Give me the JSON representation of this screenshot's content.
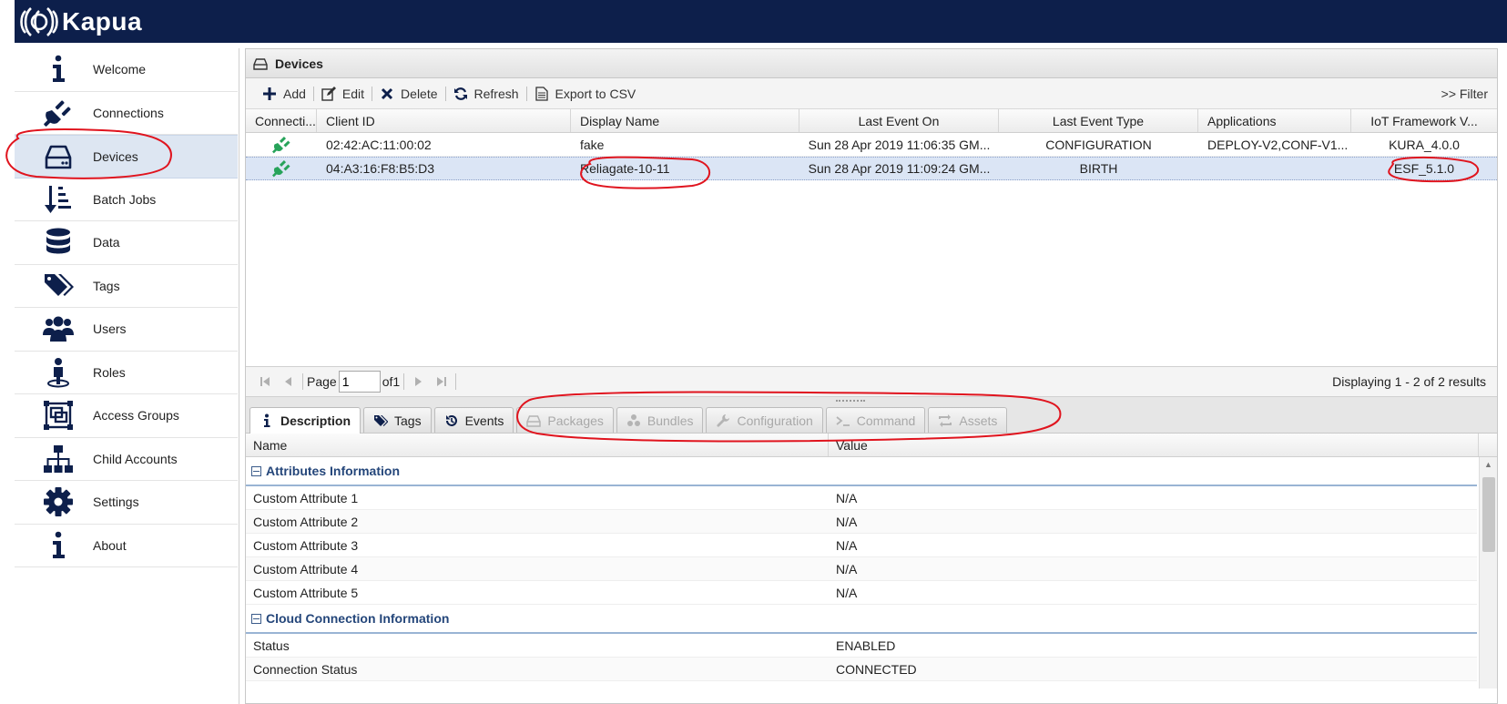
{
  "app": {
    "title": "Kapua"
  },
  "sidebar": {
    "items": [
      {
        "label": "Welcome",
        "icon": "info-icon"
      },
      {
        "label": "Connections",
        "icon": "plug-icon"
      },
      {
        "label": "Devices",
        "icon": "device-icon",
        "active": true
      },
      {
        "label": "Batch Jobs",
        "icon": "batch-jobs-icon"
      },
      {
        "label": "Data",
        "icon": "database-icon"
      },
      {
        "label": "Tags",
        "icon": "tags-icon"
      },
      {
        "label": "Users",
        "icon": "users-icon"
      },
      {
        "label": "Roles",
        "icon": "role-icon"
      },
      {
        "label": "Access Groups",
        "icon": "access-groups-icon"
      },
      {
        "label": "Child Accounts",
        "icon": "hierarchy-icon"
      },
      {
        "label": "Settings",
        "icon": "gear-icon"
      },
      {
        "label": "About",
        "icon": "info-icon"
      }
    ]
  },
  "panel": {
    "title": "Devices"
  },
  "toolbar": {
    "add": "Add",
    "edit": "Edit",
    "delete": "Delete",
    "refresh": "Refresh",
    "export": "Export to CSV",
    "filter": ">> Filter"
  },
  "grid": {
    "columns": [
      "Connecti...",
      "Client ID",
      "Display Name",
      "Last Event On",
      "Last Event Type",
      "Applications",
      "IoT Framework V..."
    ],
    "rows": [
      {
        "connection": "connected",
        "client_id": "02:42:AC:11:00:02",
        "display_name": "fake",
        "last_event_on": "Sun 28 Apr 2019 11:06:35 GM...",
        "last_event_type": "CONFIGURATION",
        "applications": "DEPLOY-V2,CONF-V1...",
        "iot_framework": "KURA_4.0.0"
      },
      {
        "connection": "connected",
        "client_id": "04:A3:16:F8:B5:D3",
        "display_name": "Reliagate-10-11",
        "last_event_on": "Sun 28 Apr 2019 11:09:24 GM...",
        "last_event_type": "BIRTH",
        "applications": "",
        "iot_framework": "ESF_5.1.0",
        "selected": true
      }
    ]
  },
  "pager": {
    "page_label": "Page",
    "page_value": "1",
    "of_label": "of1",
    "display": "Displaying 1 - 2 of 2 results"
  },
  "tabs": [
    {
      "label": "Description",
      "icon": "info-icon",
      "active": true
    },
    {
      "label": "Tags",
      "icon": "tags-icon"
    },
    {
      "label": "Events",
      "icon": "history-icon"
    },
    {
      "label": "Packages",
      "icon": "package-icon",
      "disabled": true
    },
    {
      "label": "Bundles",
      "icon": "bundles-icon",
      "disabled": true
    },
    {
      "label": "Configuration",
      "icon": "wrench-icon",
      "disabled": true
    },
    {
      "label": "Command",
      "icon": "terminal-icon",
      "disabled": true
    },
    {
      "label": "Assets",
      "icon": "assets-icon",
      "disabled": true
    }
  ],
  "props": {
    "columns": [
      "Name",
      "Value"
    ],
    "groups": [
      {
        "title": "Attributes Information",
        "rows": [
          {
            "name": "Custom Attribute 1",
            "value": "N/A"
          },
          {
            "name": "Custom Attribute 2",
            "value": "N/A"
          },
          {
            "name": "Custom Attribute 3",
            "value": "N/A"
          },
          {
            "name": "Custom Attribute 4",
            "value": "N/A"
          },
          {
            "name": "Custom Attribute 5",
            "value": "N/A"
          }
        ]
      },
      {
        "title": "Cloud Connection Information",
        "rows": [
          {
            "name": "Status",
            "value": "ENABLED"
          },
          {
            "name": "Connection Status",
            "value": "CONNECTED"
          }
        ]
      }
    ]
  },
  "colors": {
    "topbar": "#0d1f4b",
    "icon": "#0d1f4b",
    "connected": "#27a35a",
    "annotation": "#e0141e",
    "group_title": "#24467a"
  }
}
